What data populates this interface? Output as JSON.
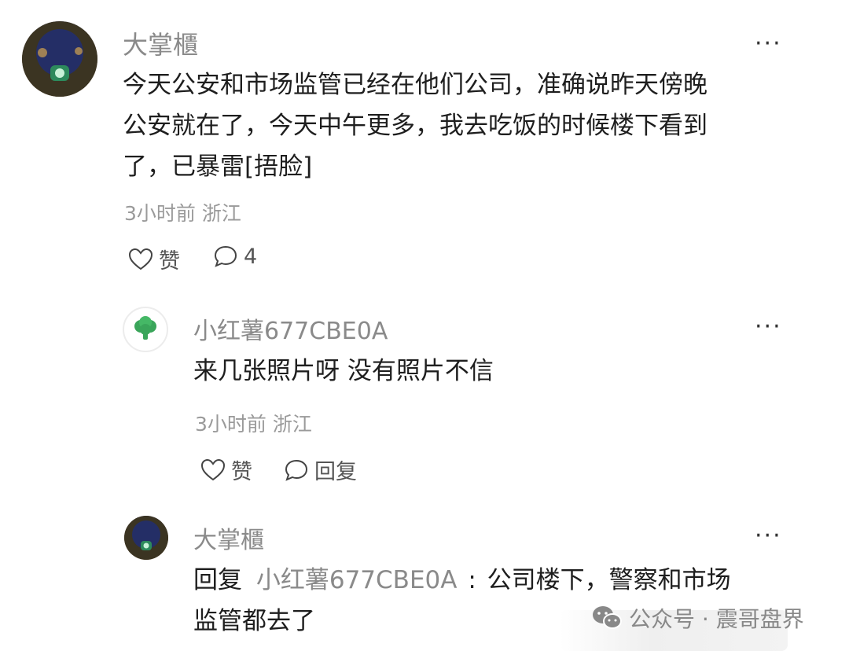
{
  "comments": [
    {
      "author": "大掌櫃",
      "text_lines": [
        "今天公安和市场监管已经在他们公司，准确说昨天傍晚",
        "公安就在了，今天中午更多，我去吃饭的时候楼下看到",
        "了，已暴雷[捂脸]"
      ],
      "meta": "3小时前 浙江",
      "like_label": "赞",
      "reply_count": "4",
      "more": "···"
    },
    {
      "author": "小红薯677CBE0A",
      "text": "来几张照片呀 没有照片不信",
      "meta": "3小时前 浙江",
      "like_label": "赞",
      "reply_label": "回复",
      "more": "···"
    },
    {
      "author": "大掌櫃",
      "reply_prefix": "回复",
      "mention": "小红薯677CBE0A",
      "colon": ":",
      "text_line1": "公司楼下，警察和市场",
      "text_line2": "监管都去了",
      "more": "···"
    }
  ],
  "watermark": {
    "text": "公众号 · 震哥盘界"
  }
}
